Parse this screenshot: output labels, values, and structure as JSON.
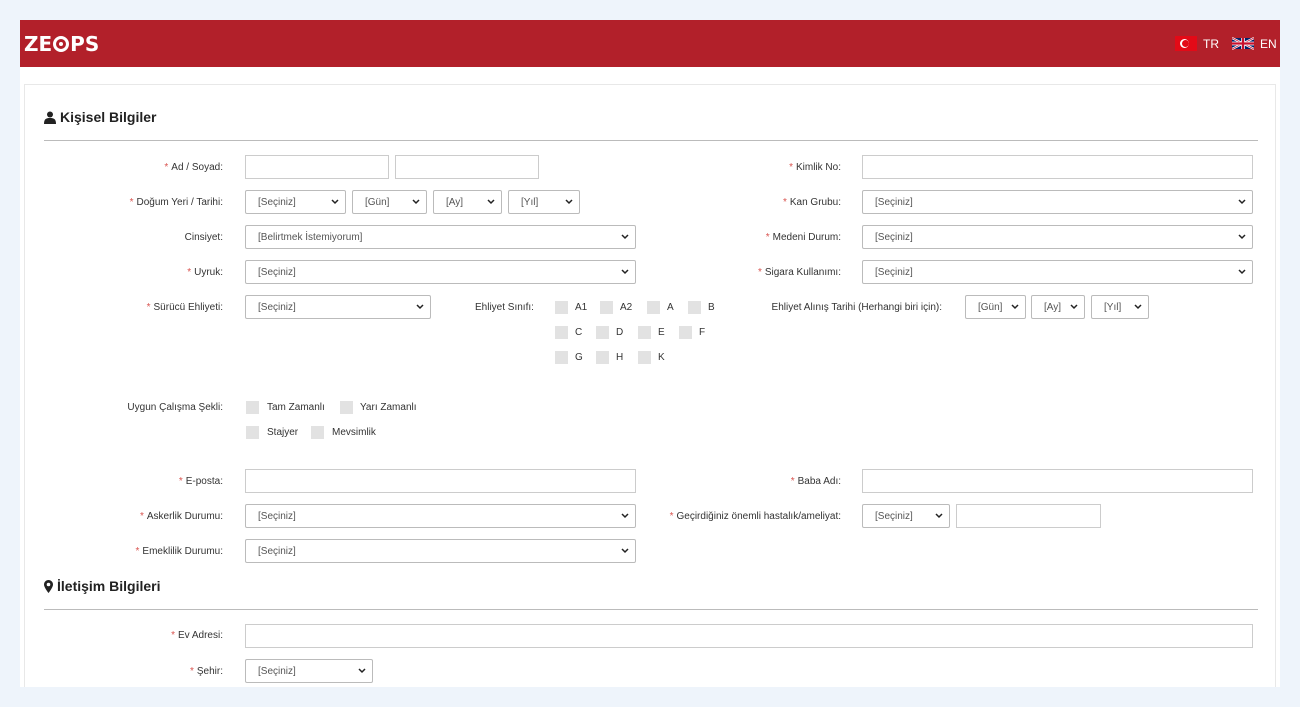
{
  "brand": {
    "logo_left": "ZE",
    "logo_right": "PS"
  },
  "lang": {
    "tr": "TR",
    "en": "EN"
  },
  "personal": {
    "title": "Kişisel Bilgiler",
    "name_label": "Ad / Soyad:",
    "id_label": "Kimlik No:",
    "birth_label": "Doğum Yeri / Tarihi:",
    "birth_place": "[Seçiniz]",
    "birth_day": "[Gün]",
    "birth_month": "[Ay]",
    "birth_year": "[Yıl]",
    "blood_label": "Kan Grubu:",
    "blood_value": "[Seçiniz]",
    "gender_label": "Cinsiyet:",
    "gender_value": "[Belirtmek İstemiyorum]",
    "marital_label": "Medeni Durum:",
    "marital_value": "[Seçiniz]",
    "nationality_label": "Uyruk:",
    "nationality_value": "[Seçiniz]",
    "smoking_label": "Sigara Kullanımı:",
    "smoking_value": "[Seçiniz]",
    "license_label": "Sürücü Ehliyeti:",
    "license_value": "[Seçiniz]",
    "license_class_label": "Ehliyet Sınıfı:",
    "license_classes": [
      "A1",
      "A2",
      "A",
      "B",
      "C",
      "D",
      "E",
      "F",
      "G",
      "H",
      "K"
    ],
    "license_date_label": "Ehliyet Alınış Tarihi (Herhangi biri için):",
    "license_day": "[Gün]",
    "license_month": "[Ay]",
    "license_year": "[Yıl]",
    "work_label": "Uygun Çalışma Şekli:",
    "work_types": [
      "Tam Zamanlı",
      "Yarı Zamanlı",
      "Stajyer",
      "Mevsimlik"
    ],
    "email_label": "E-posta:",
    "father_label": "Baba Adı:",
    "military_label": "Askerlik Durumu:",
    "military_value": "[Seçiniz]",
    "illness_label": "Geçirdiğiniz önemli hastalık/ameliyat:",
    "illness_value": "[Seçiniz]",
    "retirement_label": "Emeklilik Durumu:",
    "retirement_value": "[Seçiniz]"
  },
  "contact": {
    "title": "İletişim Bilgileri",
    "address_label": "Ev Adresi:",
    "city_label": "Şehir:",
    "city_value": "[Seçiniz]"
  },
  "colors": {
    "brand_red": "#b2202a",
    "required": "#d9534f"
  },
  "icons": {
    "personal": "user-icon",
    "contact": "map-marker-icon"
  }
}
